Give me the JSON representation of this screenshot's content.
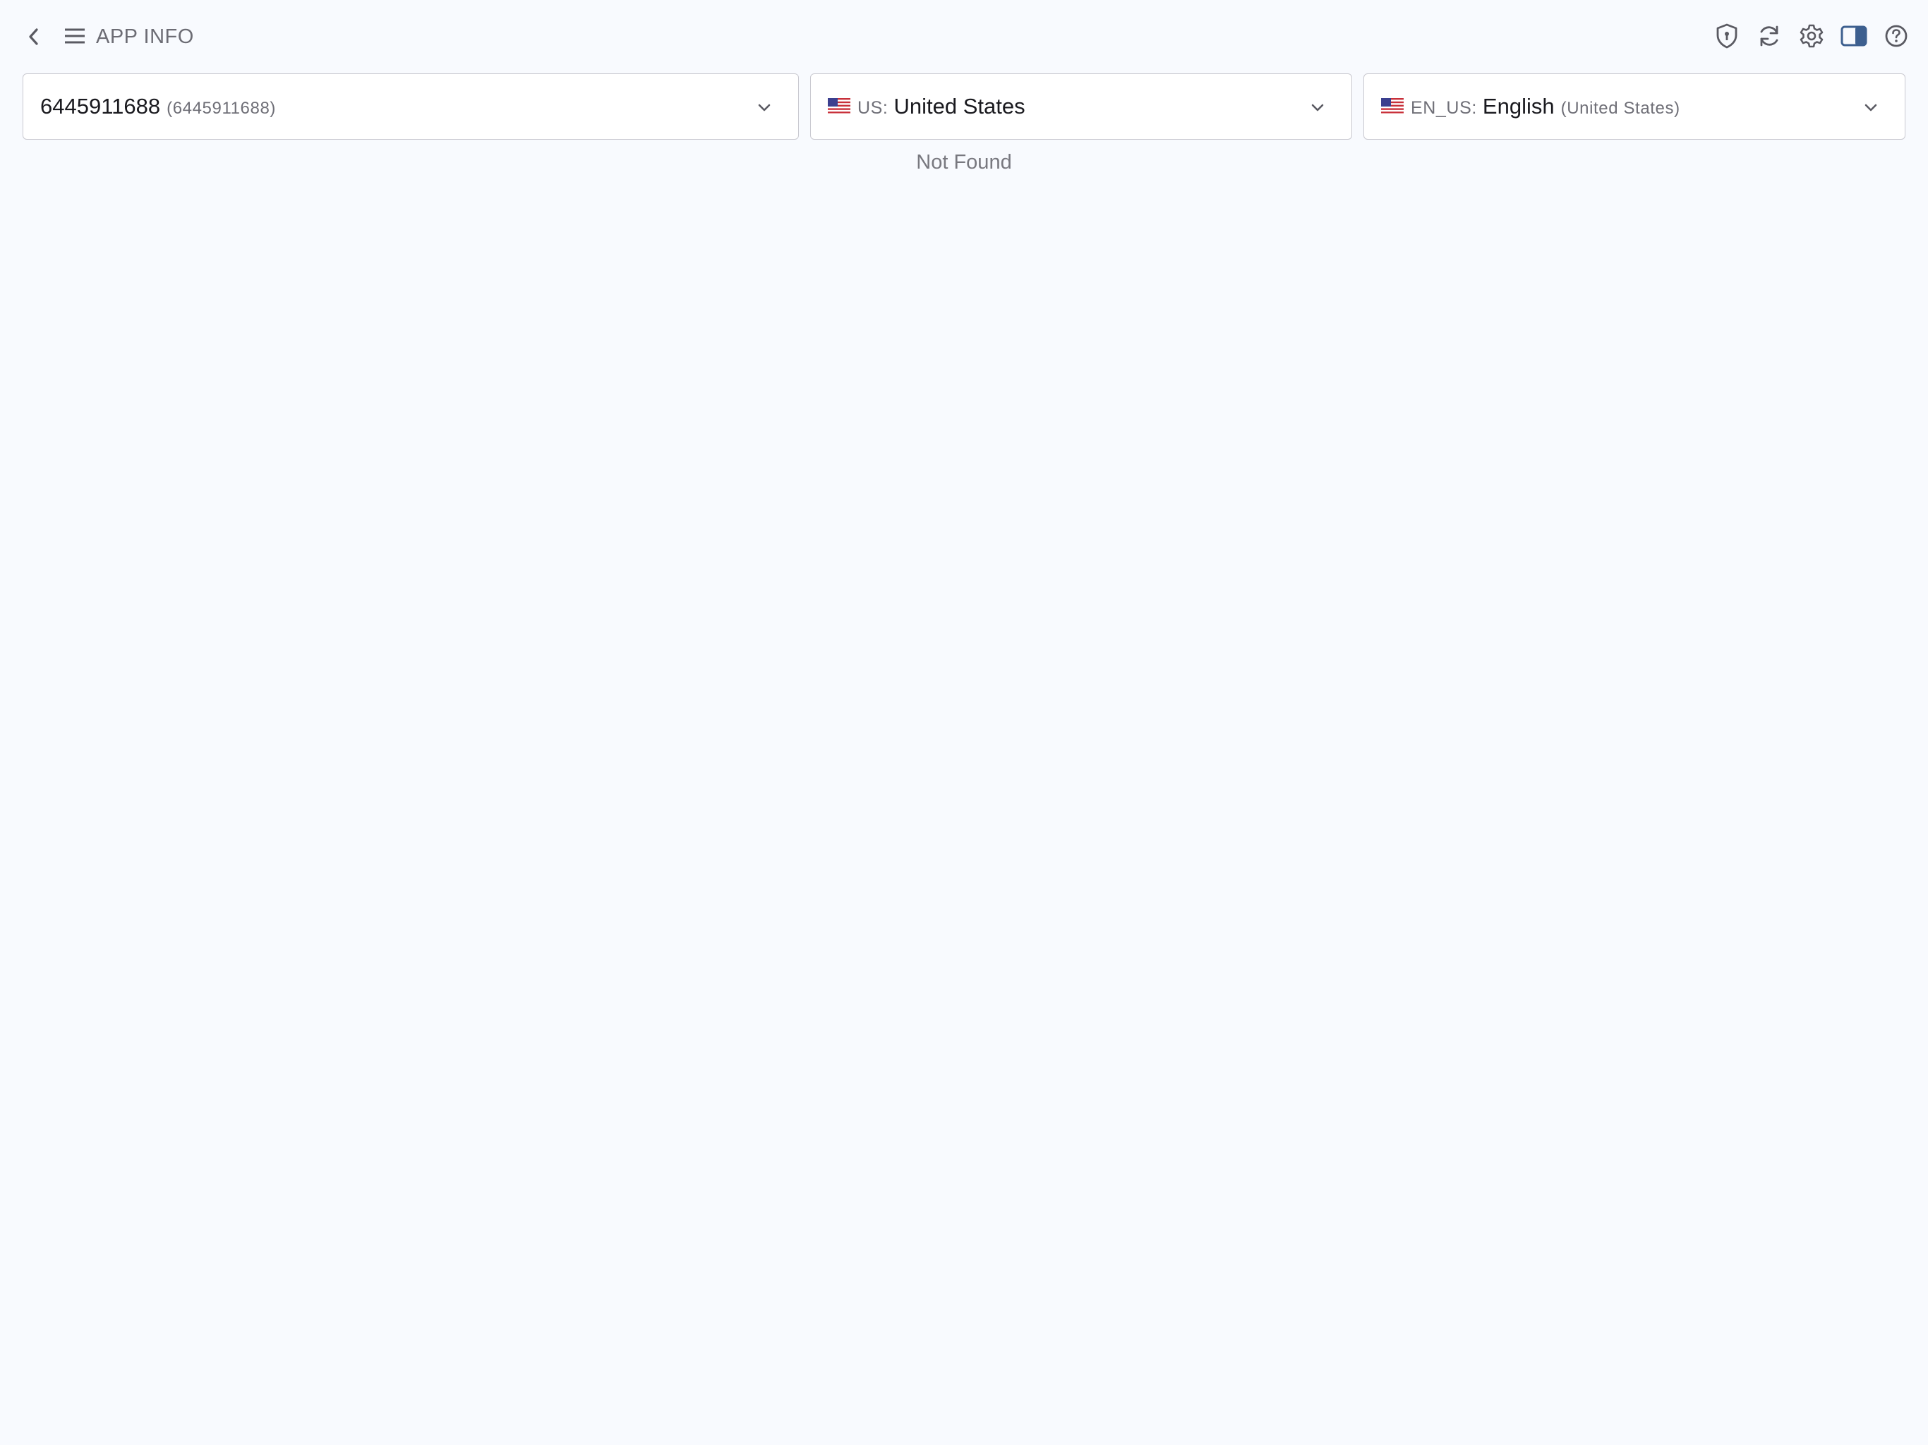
{
  "header": {
    "title": "APP INFO",
    "back_icon": "chevron-left-icon",
    "menu_icon": "hamburger-menu-icon",
    "toolbar_icons": [
      "shield-icon",
      "refresh-icon",
      "gear-icon",
      "sidebar-toggle-icon",
      "help-icon"
    ],
    "accent_color": "#3d5f8f"
  },
  "selectors": {
    "app": {
      "value": "6445911688",
      "sub": "(6445911688)"
    },
    "country": {
      "code": "US:",
      "value": "United States",
      "flag": "us-flag-icon"
    },
    "language": {
      "code": "EN_US:",
      "value": "English",
      "sub": "(United States)",
      "flag": "us-flag-icon"
    }
  },
  "status": {
    "message": "Not Found"
  }
}
